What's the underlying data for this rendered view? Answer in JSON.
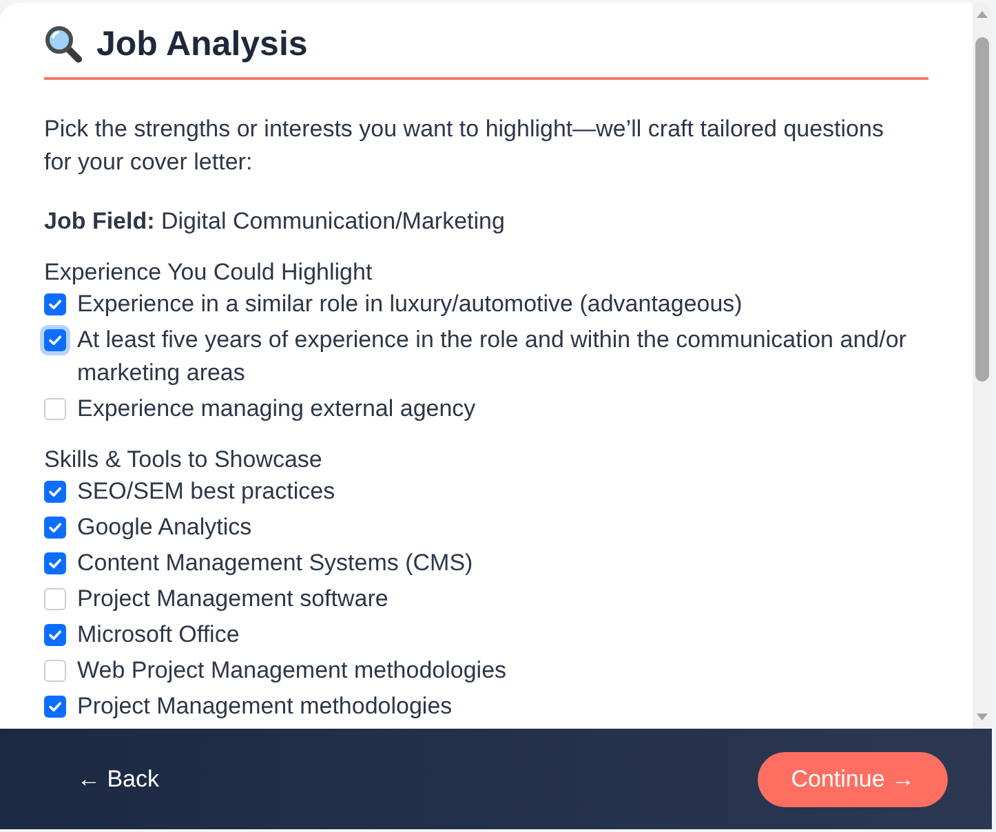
{
  "header": {
    "title": "Job Analysis"
  },
  "intro": "Pick the strengths or interests you want to highlight—we’ll craft tailored questions for your cover letter:",
  "job_field": "**Job Field:** Digital Communication/Marketing",
  "sections": [
    {
      "heading": "Experience You Could Highlight",
      "items": [
        {
          "label": "Experience in a similar role in luxury/automotive (advantageous)",
          "checked": true,
          "focused": false
        },
        {
          "label": "At least five years of experience in the role and within the communication and/or marketing areas",
          "checked": true,
          "focused": true
        },
        {
          "label": "Experience managing external agency",
          "checked": false,
          "focused": false
        }
      ]
    },
    {
      "heading": "Skills & Tools to Showcase",
      "items": [
        {
          "label": "SEO/SEM best practices",
          "checked": true,
          "focused": false
        },
        {
          "label": "Google Analytics",
          "checked": true,
          "focused": false
        },
        {
          "label": "Content Management Systems (CMS)",
          "checked": true,
          "focused": false
        },
        {
          "label": "Project Management software",
          "checked": false,
          "focused": false
        },
        {
          "label": "Microsoft Office",
          "checked": true,
          "focused": false
        },
        {
          "label": "Web Project Management methodologies",
          "checked": false,
          "focused": false
        },
        {
          "label": "Project Management methodologies",
          "checked": true,
          "focused": false
        }
      ]
    }
  ],
  "footer": {
    "back": "← Back",
    "continue": "Continue →"
  }
}
